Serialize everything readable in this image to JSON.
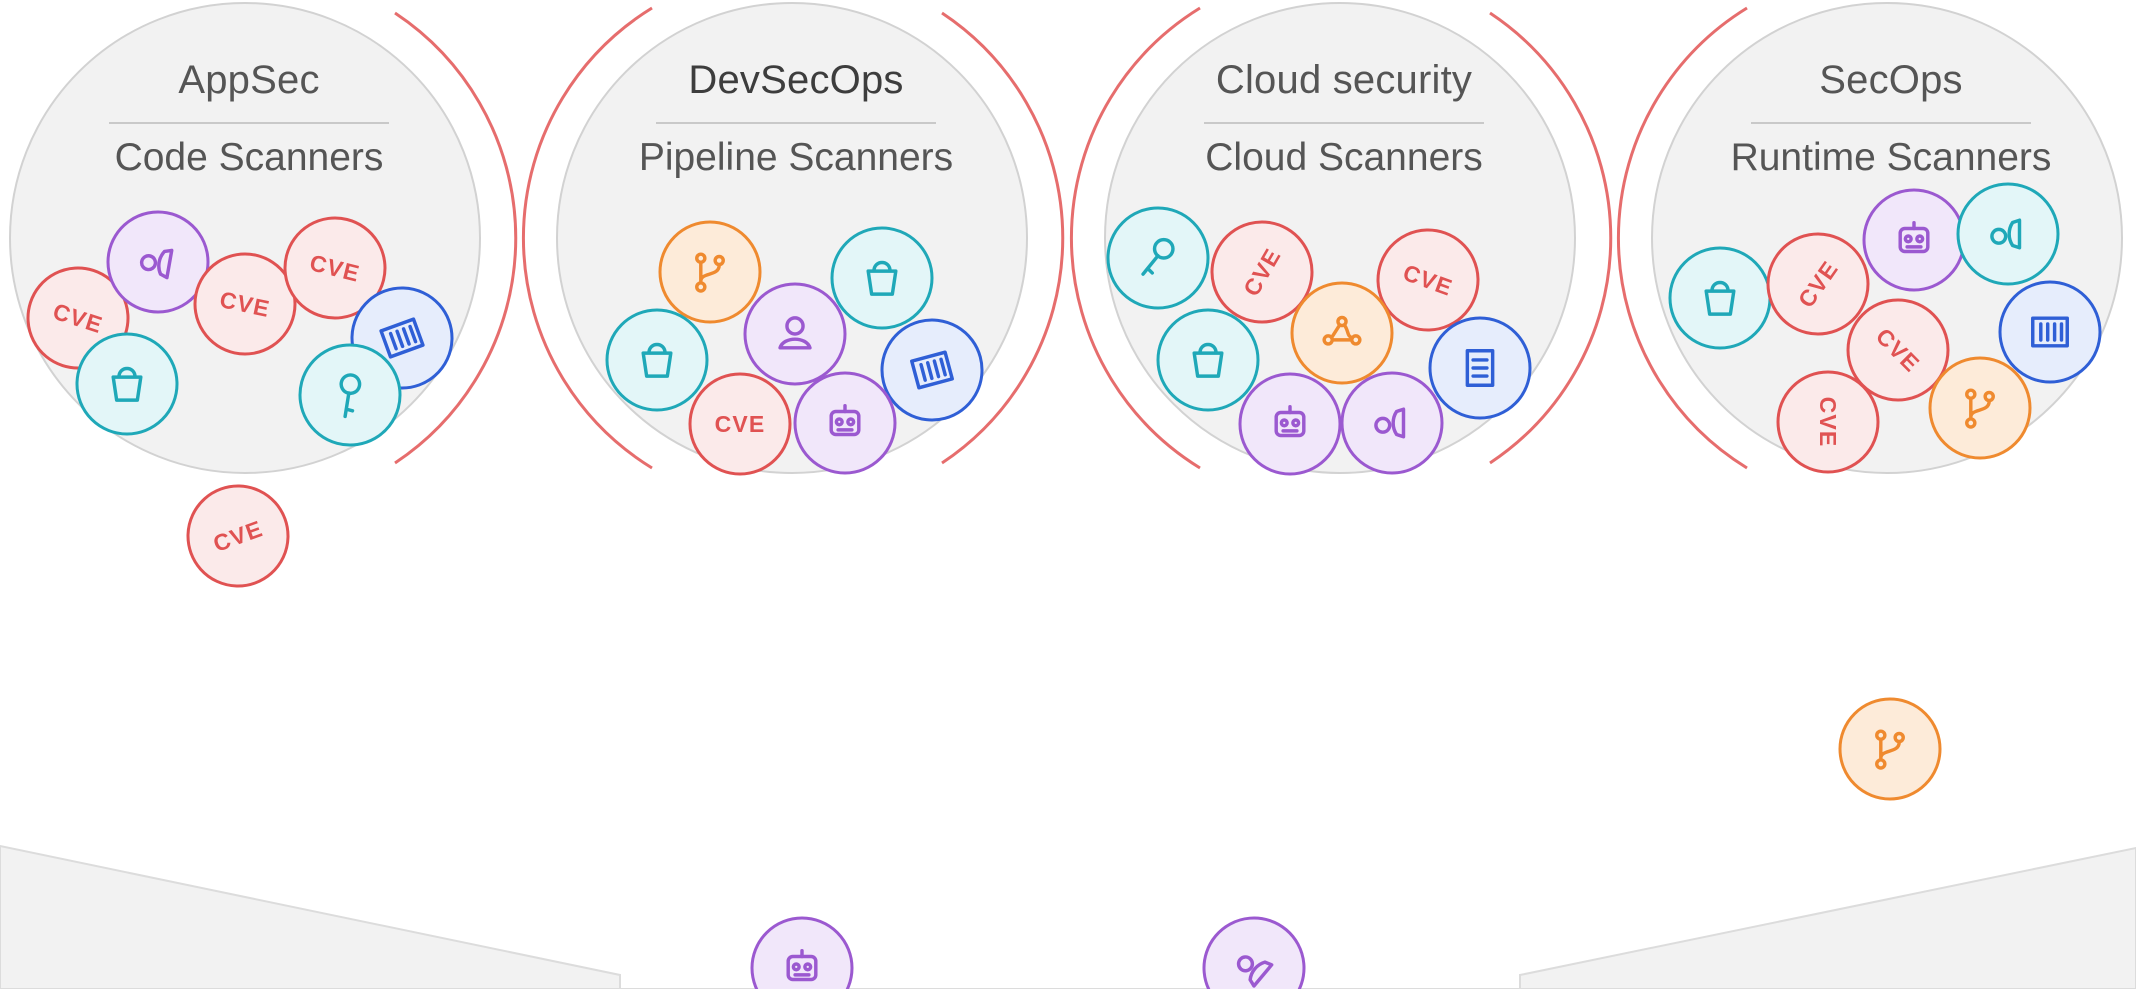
{
  "colors": {
    "cve": "#e05252",
    "secret": "#1fa8b8",
    "container": "#2f5fd6",
    "bot": "#9b59d0",
    "branch": "#ef8a2f",
    "arc": "#e04848",
    "bubble": "#f2f2f2"
  },
  "groups": [
    {
      "title": "AppSec",
      "subtitle": "Code Scanners",
      "tokens": [
        {
          "kind": "cve",
          "icon": "cve-label",
          "text": "CVE"
        },
        {
          "kind": "bot",
          "icon": "mask-icon"
        },
        {
          "kind": "cve",
          "icon": "cve-label",
          "text": "CVE"
        },
        {
          "kind": "cve",
          "icon": "cve-label",
          "text": "CVE"
        },
        {
          "kind": "secret",
          "icon": "bucket-icon"
        },
        {
          "kind": "container",
          "icon": "container-icon"
        },
        {
          "kind": "secret",
          "icon": "key-icon"
        }
      ]
    },
    {
      "title": "DevSecOps",
      "subtitle": "Pipeline Scanners",
      "tokens": [
        {
          "kind": "branch",
          "icon": "git-branch-icon"
        },
        {
          "kind": "secret",
          "icon": "bucket-icon"
        },
        {
          "kind": "bot",
          "icon": "user-icon"
        },
        {
          "kind": "secret",
          "icon": "bucket-icon"
        },
        {
          "kind": "container",
          "icon": "container-icon"
        },
        {
          "kind": "cve",
          "icon": "cve-label",
          "text": "CVE"
        },
        {
          "kind": "bot",
          "icon": "robot-icon"
        }
      ]
    },
    {
      "title": "Cloud security",
      "subtitle": "Cloud Scanners",
      "tokens": [
        {
          "kind": "secret",
          "icon": "key-icon"
        },
        {
          "kind": "cve",
          "icon": "cve-label",
          "text": "CVE"
        },
        {
          "kind": "cve",
          "icon": "cve-label",
          "text": "CVE"
        },
        {
          "kind": "branch",
          "icon": "git-merge-icon"
        },
        {
          "kind": "secret",
          "icon": "bucket-icon"
        },
        {
          "kind": "container",
          "icon": "document-icon"
        },
        {
          "kind": "bot",
          "icon": "robot-icon"
        },
        {
          "kind": "bot",
          "icon": "mask-icon"
        }
      ]
    },
    {
      "title": "SecOps",
      "subtitle": "Runtime Scanners",
      "tokens": [
        {
          "kind": "bot",
          "icon": "robot-icon"
        },
        {
          "kind": "secret",
          "icon": "mask-icon"
        },
        {
          "kind": "secret",
          "icon": "bucket-icon"
        },
        {
          "kind": "cve",
          "icon": "cve-label",
          "text": "CVE"
        },
        {
          "kind": "container",
          "icon": "container-icon"
        },
        {
          "kind": "cve",
          "icon": "cve-label",
          "text": "CVE"
        },
        {
          "kind": "cve",
          "icon": "cve-label",
          "text": "CVE"
        },
        {
          "kind": "branch",
          "icon": "git-branch-icon"
        }
      ]
    }
  ],
  "falling": [
    {
      "kind": "cve",
      "icon": "cve-label",
      "text": "CVE"
    },
    {
      "kind": "branch",
      "icon": "git-branch-icon"
    },
    {
      "kind": "bot",
      "icon": "robot-icon"
    },
    {
      "kind": "bot",
      "icon": "mask-icon"
    }
  ]
}
